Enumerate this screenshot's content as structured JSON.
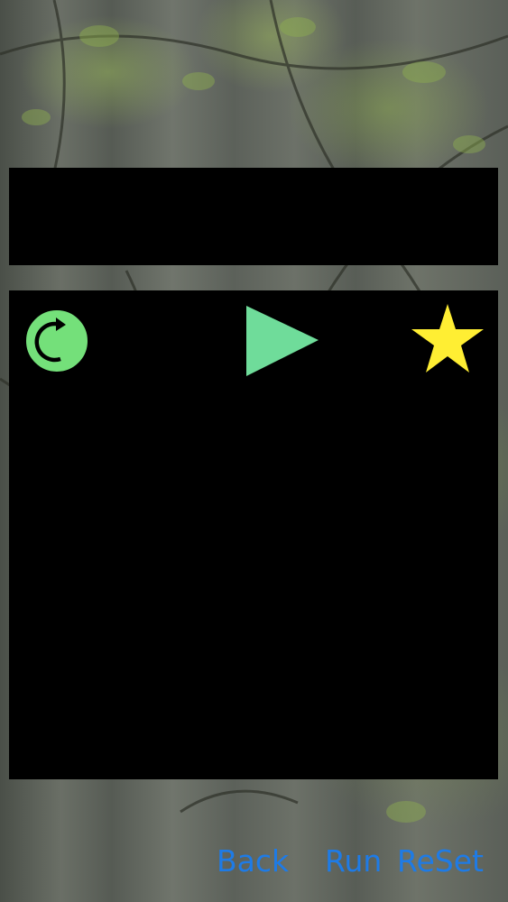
{
  "board": {
    "rows": 5,
    "cols": 5,
    "blocked_cells": [
      [
        1,
        1
      ]
    ],
    "pieces": [
      {
        "name": "rotate-token",
        "row": 0,
        "col": 0,
        "color": "#74e07a"
      },
      {
        "name": "arrow-token",
        "row": 0,
        "col": 2,
        "color": "#6fdc9a"
      },
      {
        "name": "goal-star",
        "row": 0,
        "col": 4,
        "color": "#ffee33"
      }
    ]
  },
  "command_slots": 5,
  "controls": {
    "back_label": "Back",
    "run_label": "Run",
    "reset_label": "ReSet",
    "color": "#1e7be6"
  }
}
